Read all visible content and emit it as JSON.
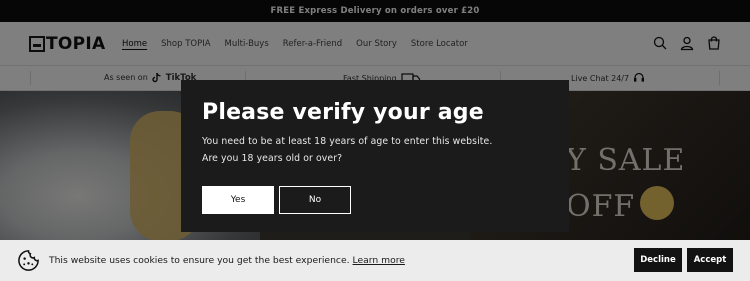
{
  "announcement": {
    "text": "FREE Express Delivery on orders over £20"
  },
  "header": {
    "logo_text": "TOPIA",
    "nav": [
      {
        "label": "Home",
        "active": true
      },
      {
        "label": "Shop TOPIA"
      },
      {
        "label": "Multi-Buys"
      },
      {
        "label": "Refer-a-Friend"
      },
      {
        "label": "Our Story"
      },
      {
        "label": "Store Locator"
      }
    ],
    "icons": [
      "search-icon",
      "account-icon",
      "cart-icon"
    ]
  },
  "usp_bar": {
    "items": [
      {
        "label": "As seen on",
        "brand": "TikTok",
        "icon": "tiktok-icon"
      },
      {
        "label": "Fast Shipping",
        "icon": "truck-icon"
      },
      {
        "label": "Live Chat 24/7",
        "icon": "chat-icon"
      }
    ]
  },
  "hero": {
    "headline_line1": "Y SALE",
    "headline_line2": "OFF"
  },
  "age_modal": {
    "title": "Please verify your age",
    "line1": "You need to be at least 18 years of age to enter this website.",
    "line2": "Are you 18 years old or over?",
    "yes_label": "Yes",
    "no_label": "No"
  },
  "cookie_banner": {
    "text": "This website uses cookies to ensure you get the best experience.",
    "link_label": "Learn more",
    "decline_label": "Decline",
    "accept_label": "Accept"
  },
  "colors": {
    "announcement_bg": "#0d0d0d",
    "modal_bg": "#1b1b1b",
    "cookie_bg": "#ececec",
    "button_dark": "#121212"
  }
}
